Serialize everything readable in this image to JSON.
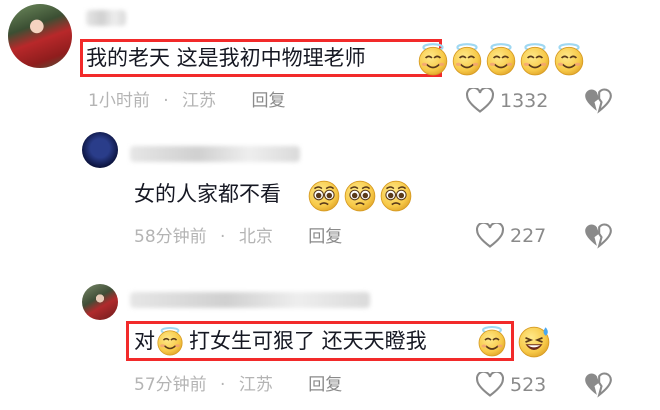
{
  "comments": [
    {
      "text": "我的老天 这是我初中物理老师",
      "emoji_after": [
        "face-with-halo-icon",
        "face-with-halo-icon",
        "face-with-halo-icon",
        "face-with-halo-icon",
        "face-with-halo-icon"
      ],
      "time": "1小时前",
      "separator": "·",
      "location": "江苏",
      "reply_label": "回复",
      "like_count": "1332"
    },
    {
      "text": "女的人家都不看",
      "emoji_after": [
        "pleading-face-icon",
        "pleading-face-icon",
        "pleading-face-icon"
      ],
      "time": "58分钟前",
      "separator": "·",
      "location": "北京",
      "reply_label": "回复",
      "like_count": "227"
    },
    {
      "text_part1": "对",
      "text_part2": "打女生可狠了 还天天瞪我",
      "emoji_inline": "face-with-halo-icon",
      "emoji_after": [
        "face-with-halo-icon",
        "grinning-sweat-face-icon"
      ],
      "time": "57分钟前",
      "separator": "·",
      "location": "江苏",
      "reply_label": "回复",
      "like_count": "523"
    }
  ],
  "colors": {
    "highlight": "#f22a2a",
    "text": "#161823",
    "meta": "#b4b4b4",
    "emoji": "#f7c948"
  }
}
